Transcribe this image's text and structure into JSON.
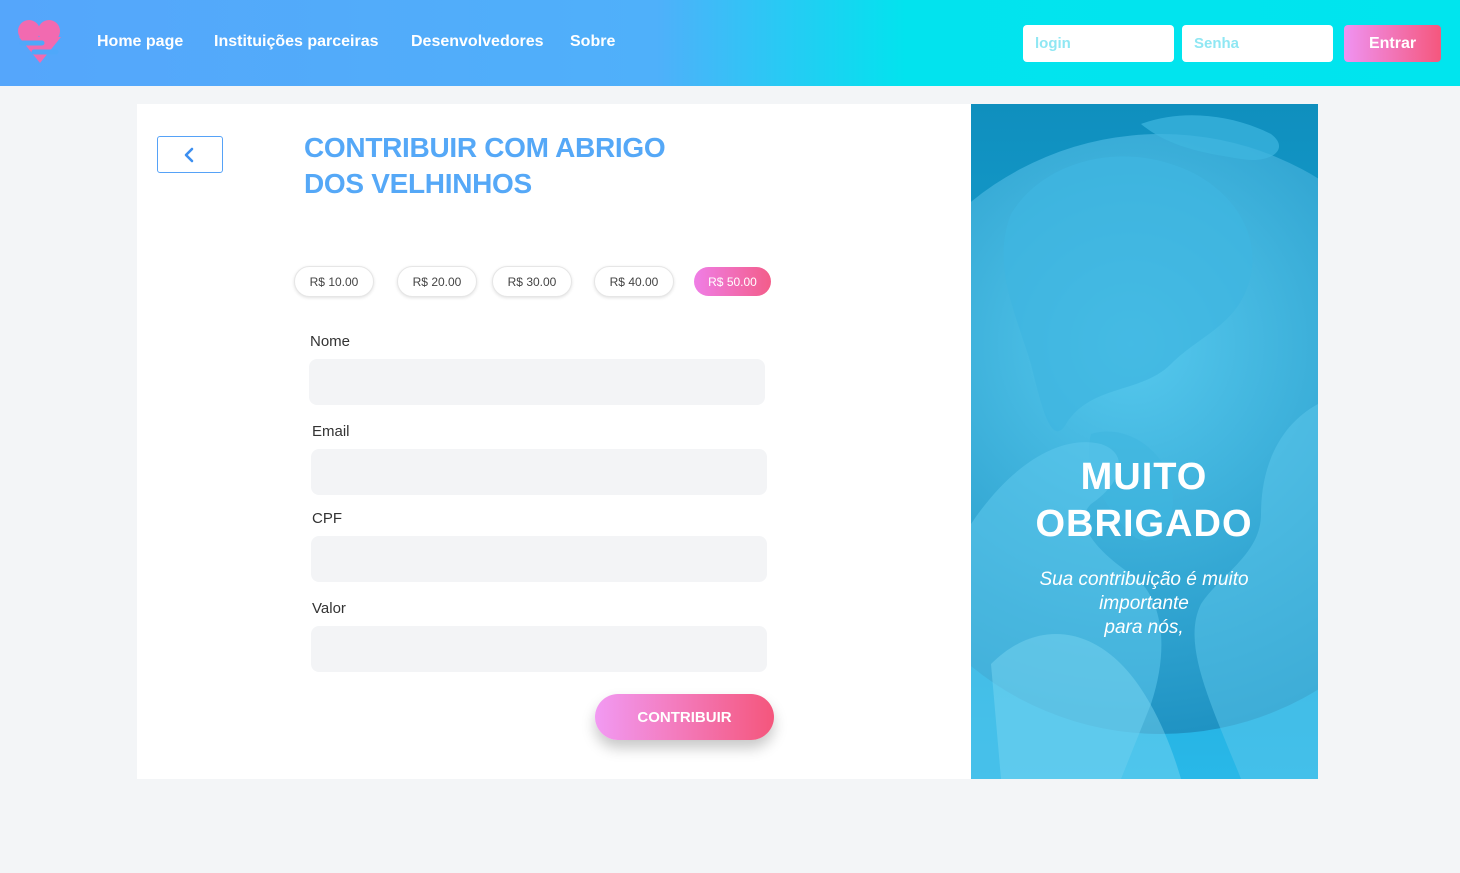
{
  "nav": {
    "links": [
      "Home page",
      "Instituições parceiras",
      "Desenvolvedores",
      "Sobre"
    ],
    "login_placeholder": "login",
    "password_placeholder": "Senha",
    "enter_label": "Entrar"
  },
  "form": {
    "title": "CONTRIBUIR COM ABRIGO DOS VELHINHOS",
    "amounts": [
      "R$ 10.00",
      "R$ 20.00",
      "R$ 30.00",
      "R$ 40.00",
      "R$ 50.00"
    ],
    "selected_amount": "R$ 50.00",
    "fields": {
      "name_label": "Nome",
      "email_label": "Email",
      "cpf_label": "CPF",
      "value_label": "Valor"
    },
    "submit_label": "CONTRIBUIR"
  },
  "thanks": {
    "title": "MUITO OBRIGADO",
    "subtitle": "Sua contribuição é muito importante\npara nós,"
  },
  "colors": {
    "accent_blue": "#55a8f7",
    "nav_gradient_start": "#55a6fb",
    "nav_gradient_end": "#00e5ee",
    "pink_gradient_start": "#ef93f2",
    "pink_gradient_end": "#f5577d"
  },
  "icons": [
    "heart-logo-icon",
    "chevron-left-icon"
  ]
}
